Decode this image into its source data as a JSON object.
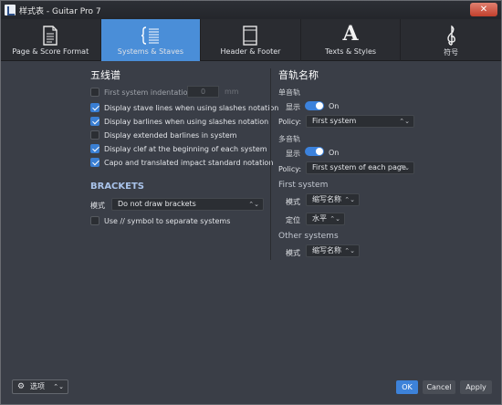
{
  "window": {
    "title": "样式表 - Guitar Pro 7",
    "close_label": "✕"
  },
  "tabs": [
    {
      "label": "Page & Score Format",
      "icon": "page-icon",
      "active": false
    },
    {
      "label": "Systems & Staves",
      "icon": "systems-icon",
      "active": true
    },
    {
      "label": "Header & Footer",
      "icon": "header-footer-icon",
      "active": false
    },
    {
      "label": "Texts & Styles",
      "icon": "text-a-icon",
      "glyph": "A",
      "active": false
    },
    {
      "label": "符号",
      "icon": "treble-clef-icon",
      "glyph": "𝄞",
      "active": false
    }
  ],
  "staves": {
    "title": "五线谱",
    "first_indent": {
      "label": "First system indentation",
      "checked": false,
      "value": "0",
      "unit": "mm"
    },
    "options": [
      {
        "label": "Display stave lines when using slashes notation",
        "checked": true
      },
      {
        "label": "Display barlines when using slashes notation",
        "checked": true
      },
      {
        "label": "Display extended barlines in system",
        "checked": false
      },
      {
        "label": "Display clef at the beginning of each system",
        "checked": true
      },
      {
        "label": "Capo and translated impact standard notation",
        "checked": true
      }
    ]
  },
  "brackets": {
    "title": "BRACKETS",
    "mode_label": "模式",
    "mode_value": "Do not draw brackets",
    "separator": {
      "label": "Use // symbol to separate systems",
      "checked": false
    }
  },
  "track_names": {
    "title": "音轨名称",
    "single": {
      "heading": "单音轨",
      "show_label": "显示",
      "toggle_state": "On",
      "policy_label": "Policy:",
      "policy_value": "First system"
    },
    "multi": {
      "heading": "多音轨",
      "show_label": "显示",
      "toggle_state": "On",
      "policy_label": "Policy:",
      "policy_value": "First system of each page"
    },
    "first_system": {
      "heading": "First system",
      "mode_label": "模式",
      "mode_value": "缩写名称",
      "position_label": "定位",
      "position_value": "水平"
    },
    "other_systems": {
      "heading": "Other systems",
      "mode_label": "模式",
      "mode_value": "缩写名称"
    }
  },
  "footer": {
    "options_label": "选项",
    "ok_label": "OK",
    "cancel_label": "Cancel",
    "apply_label": "Apply"
  },
  "colors": {
    "accent": "#4a8ed8",
    "background": "#3a3e47",
    "tabbar": "#2a2c31"
  }
}
